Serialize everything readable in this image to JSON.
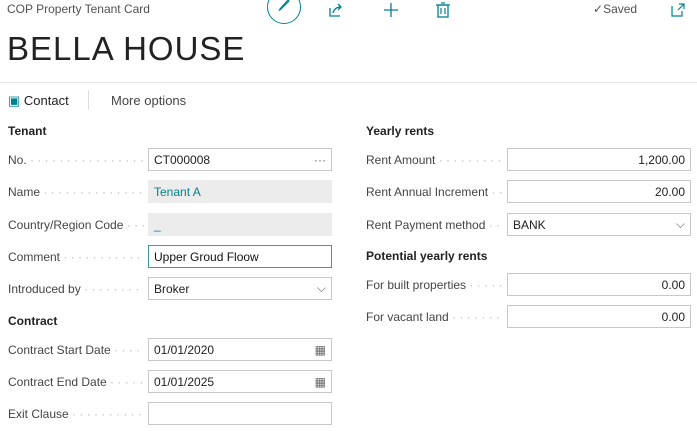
{
  "header": {
    "caption": "COP Property Tenant Card",
    "title": "BELLA HOUSE",
    "status": "Saved",
    "icons": [
      "edit-icon",
      "share-icon",
      "add-icon",
      "delete-icon",
      "checkmark-icon",
      "open-new-window-icon"
    ]
  },
  "actions": {
    "contact": "Contact",
    "more": "More options"
  },
  "tenant": {
    "heading": "Tenant",
    "no": {
      "label": "No.",
      "value": "CT000008"
    },
    "name": {
      "label": "Name",
      "value": "Tenant A"
    },
    "country": {
      "label": "Country/Region Code",
      "value": "_"
    },
    "comment": {
      "label": "Comment",
      "value": "Upper Groud Floow"
    },
    "introduced": {
      "label": "Introduced by",
      "value": "Broker"
    }
  },
  "contract": {
    "heading": "Contract",
    "start": {
      "label": "Contract Start Date",
      "value": "01/01/2020"
    },
    "end": {
      "label": "Contract End Date",
      "value": "01/01/2025"
    },
    "exit": {
      "label": "Exit Clause",
      "value": ""
    }
  },
  "yearly": {
    "heading": "Yearly rents",
    "amount": {
      "label": "Rent Amount",
      "value": "1,200.00"
    },
    "increment": {
      "label": "Rent Annual Increment",
      "value": "20.00"
    },
    "method": {
      "label": "Rent Payment method",
      "value": "BANK"
    }
  },
  "potential": {
    "heading": "Potential yearly rents",
    "built": {
      "label": "For built properties",
      "value": "0.00"
    },
    "vacant": {
      "label": "For vacant land",
      "value": "0.00"
    }
  },
  "colors": {
    "accent": "#00838f"
  }
}
